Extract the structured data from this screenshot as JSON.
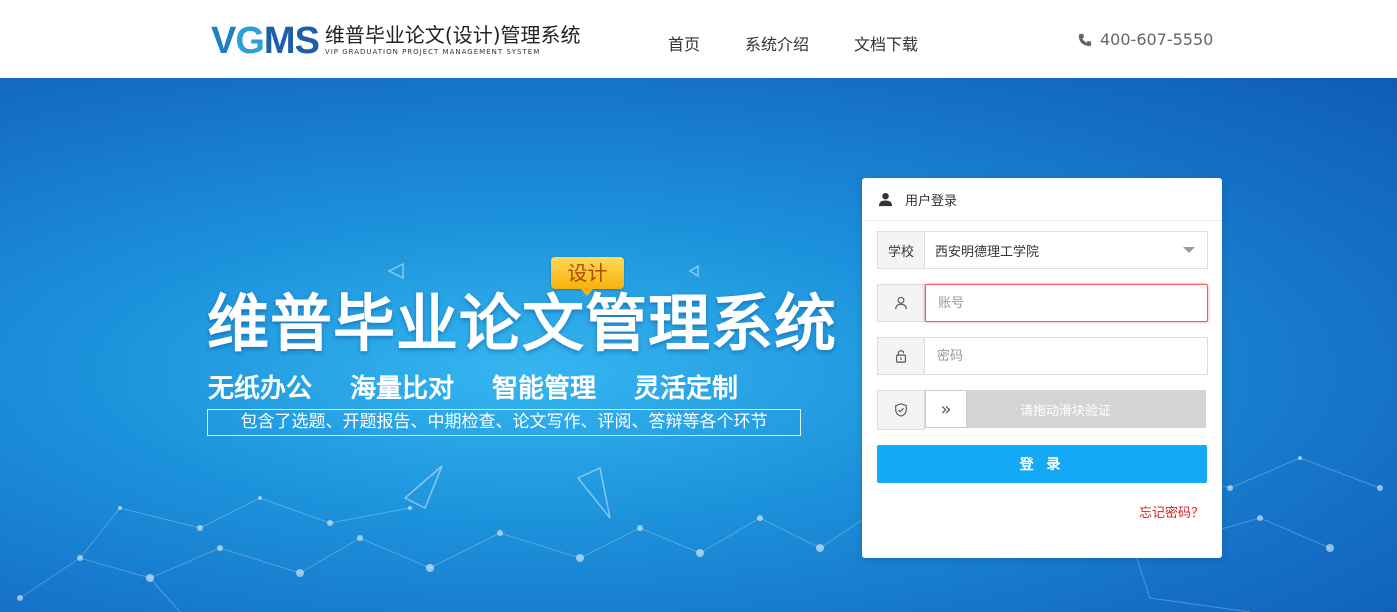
{
  "header": {
    "logo_mark_v": "V",
    "logo_mark_g": "G",
    "logo_mark_ms": "MS",
    "logo_cn": "维普毕业论文(设计)管理系统",
    "logo_en": "VIP GRADUATION PROJECT MANAGEMENT SYSTEM",
    "nav": [
      "首页",
      "系统介绍",
      "文档下载"
    ],
    "phone": "400-607-5550",
    "phone_icon": "phone-icon"
  },
  "hero": {
    "badge": "设计",
    "title": "维普毕业论文管理系统",
    "tags": [
      "无纸办公",
      "海量比对",
      "智能管理",
      "灵活定制"
    ],
    "desc": "包含了选题、开题报告、中期检查、论文写作、评阅、答辩等各个环节"
  },
  "login": {
    "title": "用户登录",
    "school_label": "学校",
    "school_value": "西安明德理工学院",
    "account_placeholder": "账号",
    "password_placeholder": "密码",
    "slider_text": "请拖动滑块验证",
    "slider_handle": "»",
    "submit": "登 录",
    "forgot": "忘记密码？"
  },
  "colors": {
    "primary_button": "#14a9f4",
    "forgot_link": "#e02020",
    "active_border": "#f06060"
  }
}
